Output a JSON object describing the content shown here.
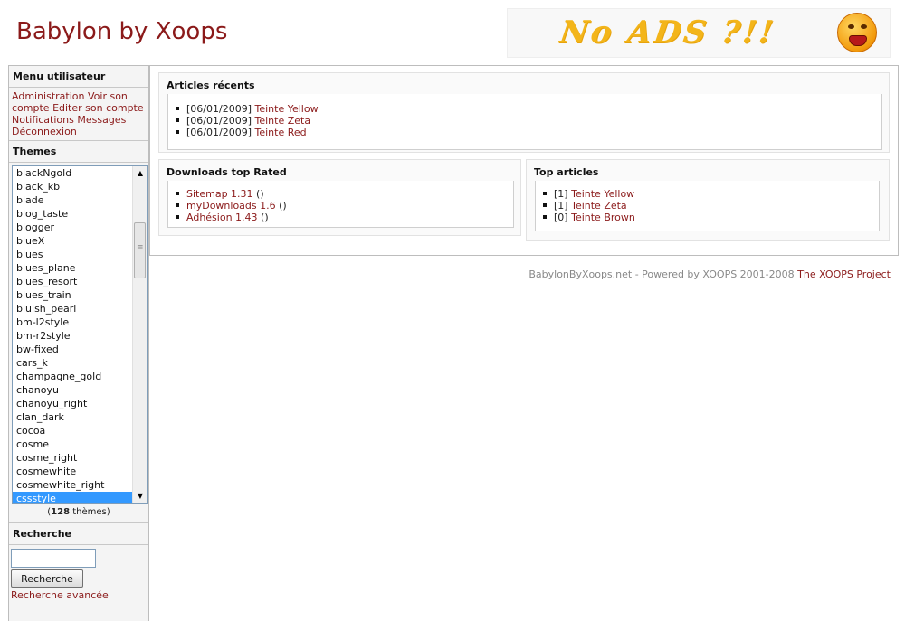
{
  "header": {
    "site_title": "Babylon by Xoops",
    "banner_text": "No ADS ?!!",
    "banner_icon": "screaming-face-icon"
  },
  "sidebar": {
    "user_menu_title": "Menu utilisateur",
    "user_menu_links": [
      "Administration",
      "Voir son compte",
      "Editer son compte",
      "Notifications",
      "Messages",
      "Déconnexion"
    ],
    "themes_title": "Themes",
    "themes": [
      "blackNgold",
      "black_kb",
      "blade",
      "blog_taste",
      "blogger",
      "blueX",
      "blues",
      "blues_plane",
      "blues_resort",
      "blues_train",
      "bluish_pearl",
      "bm-l2style",
      "bm-r2style",
      "bw-fixed",
      "cars_k",
      "champagne_gold",
      "chanoyu",
      "chanoyu_right",
      "clan_dark",
      "cocoa",
      "cosme",
      "cosme_right",
      "cosmewhite",
      "cosmewhite_right",
      "cssstyle"
    ],
    "selected_theme": "cssstyle",
    "theme_count_number": "128",
    "theme_count_suffix": " thèmes)",
    "theme_count_prefix": "(",
    "search_title": "Recherche",
    "search_input_value": "",
    "search_button_label": "Recherche",
    "advanced_search_label": "Recherche avancée"
  },
  "main": {
    "recent_title": "Articles récents",
    "recent_items": [
      {
        "date": "[06/01/2009]",
        "title": "Teinte Yellow"
      },
      {
        "date": "[06/01/2009]",
        "title": "Teinte Zeta"
      },
      {
        "date": "[06/01/2009]",
        "title": "Teinte Red"
      }
    ],
    "downloads_title": "Downloads top Rated",
    "downloads_items": [
      {
        "title": "Sitemap 1.31",
        "suffix": " ()"
      },
      {
        "title": "myDownloads 1.6",
        "suffix": " ()"
      },
      {
        "title": "Adhésion 1.43",
        "suffix": " ()"
      }
    ],
    "top_title": "Top articles",
    "top_items": [
      {
        "rank": "[1]",
        "title": "Teinte Yellow"
      },
      {
        "rank": "[1]",
        "title": "Teinte Zeta"
      },
      {
        "rank": "[0]",
        "title": "Teinte Brown"
      }
    ]
  },
  "footer": {
    "text": "BabylonByXoops.net - Powered by XOOPS 2001-2008 ",
    "link": "The XOOPS Project"
  },
  "colors": {
    "accent": "#8b1a1a",
    "selection": "#3399ff",
    "banner_text": "#f3b51a"
  }
}
